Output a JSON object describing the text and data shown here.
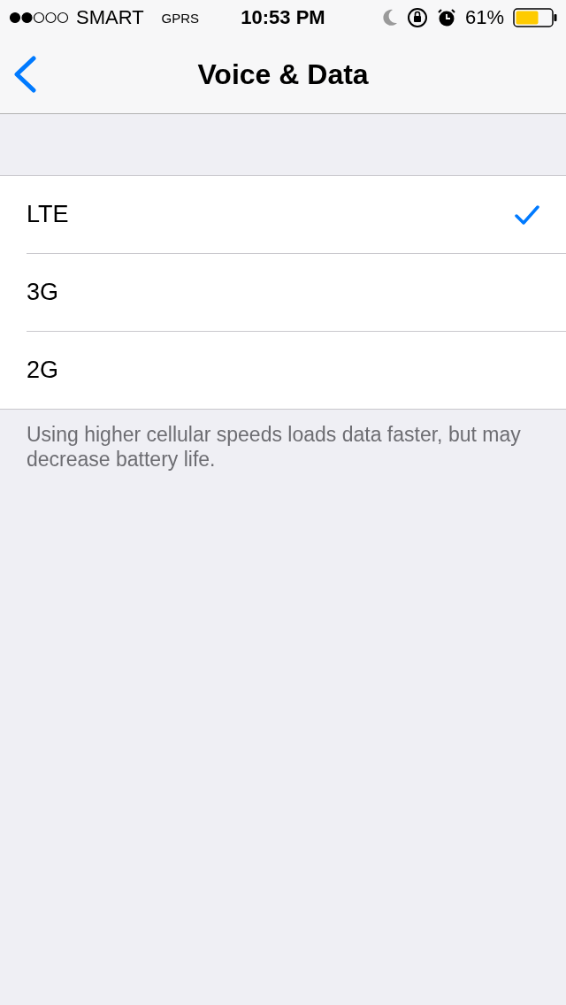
{
  "status_bar": {
    "carrier": "SMART",
    "network": "GPRS",
    "time": "10:53 PM",
    "battery_percent": "61%"
  },
  "nav": {
    "title": "Voice & Data"
  },
  "options": [
    {
      "label": "LTE",
      "selected": true
    },
    {
      "label": "3G",
      "selected": false
    },
    {
      "label": "2G",
      "selected": false
    }
  ],
  "footer": "Using higher cellular speeds loads data faster, but may decrease battery life."
}
